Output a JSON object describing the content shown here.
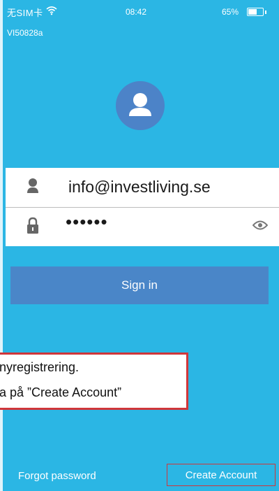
{
  "statusbar": {
    "carrier": "无SIM卡",
    "time": "08:42",
    "battery": "65%"
  },
  "device_id": "VI50828a",
  "login": {
    "email_value": "info@investliving.se",
    "password_value": "••••••"
  },
  "buttons": {
    "sign_in": "Sign in",
    "forgot_password": "Forgot password",
    "create_account": "Create Account"
  },
  "annotation": {
    "line1": "nyregistrering.",
    "line2": "a på ”Create Account”"
  },
  "colors": {
    "background": "#2bb6e4",
    "button": "#4a86c8",
    "avatar": "#4c83c8",
    "highlight": "#d0363a"
  },
  "icons": {
    "wifi": "wifi-icon",
    "battery": "battery-icon",
    "avatar": "user-avatar-icon",
    "user": "user-icon",
    "lock": "lock-icon",
    "eye": "eye-icon"
  }
}
